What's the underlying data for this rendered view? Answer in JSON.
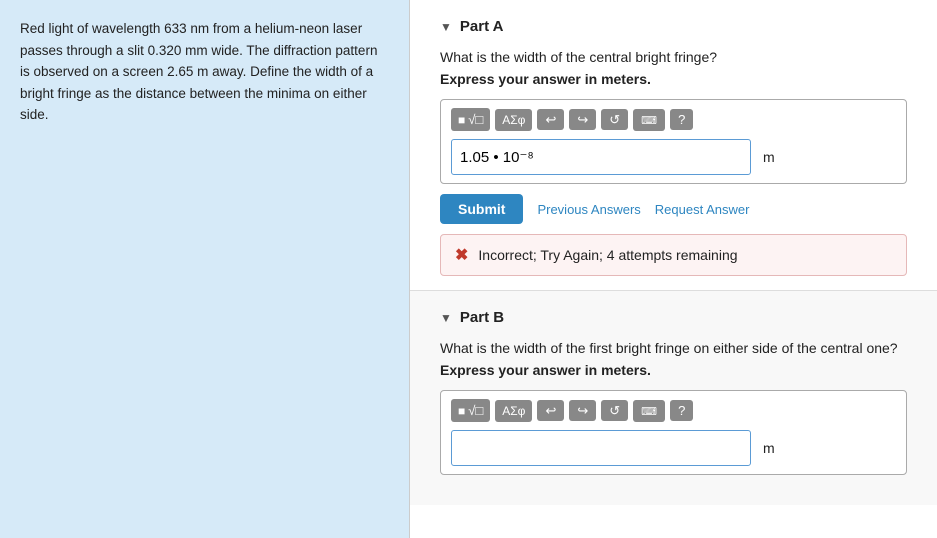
{
  "leftPanel": {
    "text": "Red light of wavelength 633 nm from a helium-neon laser passes through a slit 0.320 mm wide. The diffraction pattern is observed on a screen 2.65 m away. Define the width of a bright fringe as the distance between the minima on either side."
  },
  "partA": {
    "label": "Part A",
    "question": "What is the width of the central bright fringe?",
    "instruction": "Express your answer in meters.",
    "toolbar": {
      "mathBtn": "⬛√□",
      "sigmaBtn": "ΑΣφ",
      "undoBtn": "↩",
      "redoBtn": "↪",
      "refreshBtn": "↺",
      "keyboardBtn": "⌨",
      "helpBtn": "?"
    },
    "inputValue": "1.05 • 10",
    "exponent": "−8",
    "unit": "m",
    "submitLabel": "Submit",
    "prevAnswersLabel": "Previous Answers",
    "requestAnswerLabel": "Request Answer",
    "feedback": "Incorrect; Try Again; 4 attempts remaining"
  },
  "partB": {
    "label": "Part B",
    "question": "What is the width of the first bright fringe on either side of the central one?",
    "instruction": "Express your answer in meters.",
    "toolbar": {
      "mathBtn": "⬛√□",
      "sigmaBtn": "ΑΣφ",
      "undoBtn": "↩",
      "redoBtn": "↪",
      "refreshBtn": "↺",
      "keyboardBtn": "⌨",
      "helpBtn": "?"
    },
    "inputValue": "",
    "unit": "m"
  }
}
